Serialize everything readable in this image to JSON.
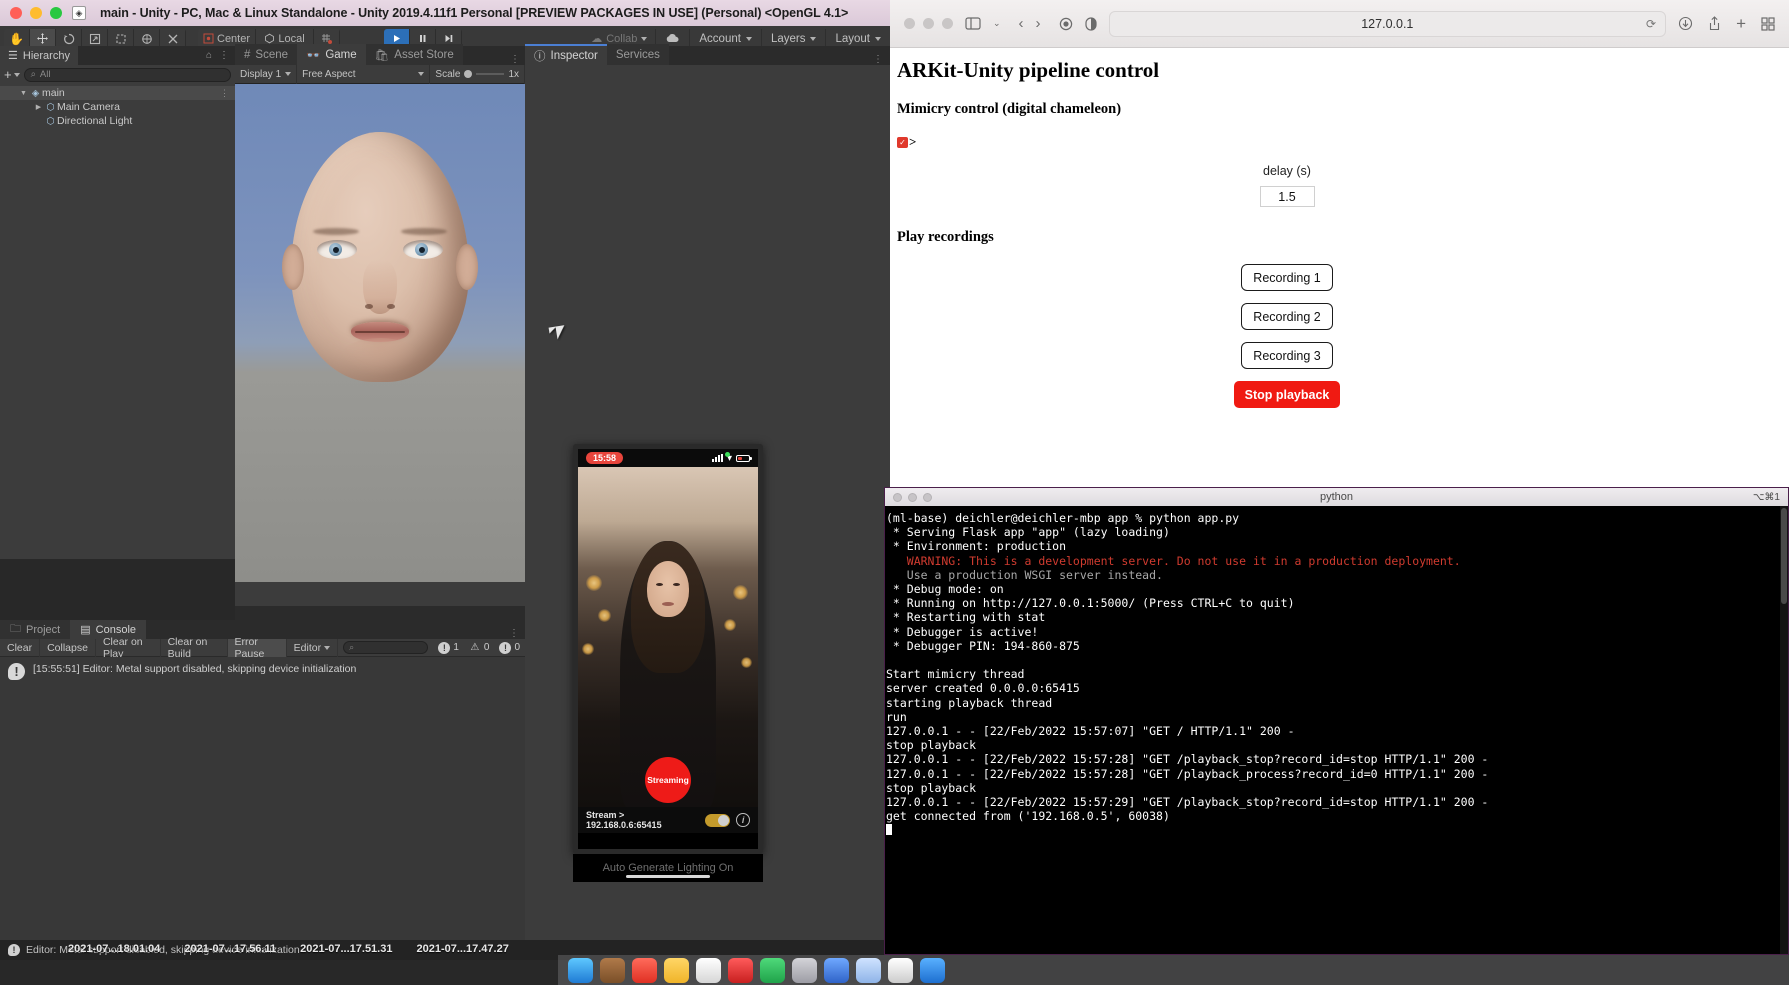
{
  "unity": {
    "window_title": "main - Unity - PC, Mac & Linux Standalone - Unity 2019.4.11f1 Personal [PREVIEW PACKAGES IN USE] (Personal) <OpenGL 4.1>",
    "toolbar": {
      "pivot_mode": "Center",
      "space_mode": "Local",
      "collab": "Collab",
      "account": "Account",
      "layers": "Layers",
      "layout": "Layout"
    },
    "hierarchy": {
      "tab_label": "Hierarchy",
      "search_placeholder": "All",
      "items": [
        {
          "label": "main",
          "indent": 0,
          "selected": true,
          "expanded": true
        },
        {
          "label": "Main Camera",
          "indent": 1,
          "selected": false,
          "expanded": false
        },
        {
          "label": "Directional Light",
          "indent": 1,
          "selected": false,
          "expanded": false
        }
      ]
    },
    "scene_tabs": [
      {
        "label": "Scene",
        "selected": false
      },
      {
        "label": "Game",
        "selected": true
      },
      {
        "label": "Asset Store",
        "selected": false
      }
    ],
    "game_toolbar": {
      "display": "Display 1",
      "aspect": "Free Aspect",
      "scale_label": "Scale",
      "scale_value": "1x"
    },
    "inspector_tabs": [
      {
        "label": "Inspector",
        "selected": true
      },
      {
        "label": "Services",
        "selected": false
      }
    ],
    "console": {
      "tabs": [
        {
          "label": "Project",
          "selected": false
        },
        {
          "label": "Console",
          "selected": true
        }
      ],
      "buttons": [
        "Clear",
        "Collapse",
        "Clear on Play",
        "Clear on Build",
        "Error Pause"
      ],
      "filter": "Editor",
      "search_placeholder": "",
      "counts": {
        "errors": "1",
        "warnings": "0",
        "infos": "0"
      },
      "entries": [
        {
          "text": "[15:55:51] Editor: Metal support disabled, skipping device initialization"
        }
      ]
    },
    "status_bar": "Editor: Metal support disabled, skipping device initialization"
  },
  "phone": {
    "time": "15:58",
    "record_label": "Streaming",
    "stream_label": "Stream > 192.168.0.6:65415"
  },
  "unity_footer_note": "Auto Generate Lighting On",
  "taskbar": {
    "items": [
      "2021-07...18.01.04",
      "2021-07...17.56.11",
      "2021-07...17.51.31",
      "2021-07...17.47.27"
    ]
  },
  "safari": {
    "url": "127.0.0.1",
    "page": {
      "title": "ARKit-Unity pipeline control",
      "mimicry_heading": "Mimicry control (digital chameleon)",
      "mimicry_checkbox_checked": true,
      "mimicry_arrow": ">",
      "delay_label": "delay (s)",
      "delay_value": "1.5",
      "play_heading": "Play recordings",
      "recordings": [
        "Recording 1",
        "Recording 2",
        "Recording 3"
      ],
      "stop_label": "Stop playback",
      "stop_color": "#f01a12"
    }
  },
  "terminal": {
    "title": "python",
    "shortcut": "⌥⌘1",
    "lines": [
      {
        "text": "(ml-base) deichler@deichler-mbp app % python app.py",
        "style": "normal"
      },
      {
        "text": " * Serving Flask app \"app\" (lazy loading)",
        "style": "normal"
      },
      {
        "text": " * Environment: production",
        "style": "normal"
      },
      {
        "text": "   WARNING: This is a development server. Do not use it in a production deployment.",
        "style": "warn"
      },
      {
        "text": "   Use a production WSGI server instead.",
        "style": "dim"
      },
      {
        "text": " * Debug mode: on",
        "style": "normal"
      },
      {
        "text": " * Running on http://127.0.0.1:5000/ (Press CTRL+C to quit)",
        "style": "normal"
      },
      {
        "text": " * Restarting with stat",
        "style": "normal"
      },
      {
        "text": " * Debugger is active!",
        "style": "normal"
      },
      {
        "text": " * Debugger PIN: 194-860-875",
        "style": "normal"
      },
      {
        "text": "",
        "style": "normal"
      },
      {
        "text": "Start mimicry thread",
        "style": "normal"
      },
      {
        "text": "server created 0.0.0.0:65415",
        "style": "normal"
      },
      {
        "text": "starting playback thread",
        "style": "normal"
      },
      {
        "text": "run",
        "style": "normal"
      },
      {
        "text": "127.0.0.1 - - [22/Feb/2022 15:57:07] \"GET / HTTP/1.1\" 200 -",
        "style": "normal"
      },
      {
        "text": "stop playback",
        "style": "normal"
      },
      {
        "text": "127.0.0.1 - - [22/Feb/2022 15:57:28] \"GET /playback_stop?record_id=stop HTTP/1.1\" 200 -",
        "style": "normal"
      },
      {
        "text": "127.0.0.1 - - [22/Feb/2022 15:57:28] \"GET /playback_process?record_id=0 HTTP/1.1\" 200 -",
        "style": "normal"
      },
      {
        "text": "stop playback",
        "style": "normal"
      },
      {
        "text": "127.0.0.1 - - [22/Feb/2022 15:57:29] \"GET /playback_stop?record_id=stop HTTP/1.1\" 200 -",
        "style": "normal"
      },
      {
        "text": "get connected from ('192.168.0.5', 60038)",
        "style": "normal"
      }
    ]
  }
}
